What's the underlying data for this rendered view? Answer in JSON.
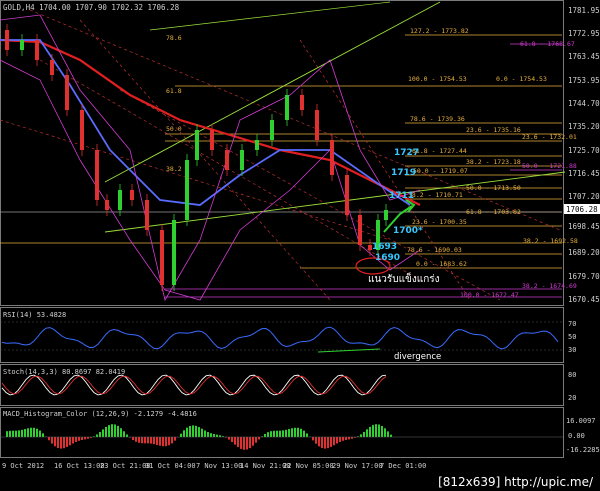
{
  "window_title": "GOLD,H4  1704.00 1707.90 1702.32 1706.28",
  "colors": {
    "background": "#000000",
    "fib_orange": "#e8b040",
    "fib_magenta": "#d23cd2",
    "ma_red": "#e02020",
    "ma_blue": "#5a6cff",
    "trend_green": "#9be03a",
    "candle_up": "#2fd02f",
    "candle_down": "#e03030",
    "cyan_text": "#38c8ff",
    "rsi_line": "#3a6cff",
    "stoch_main": "#ffffff",
    "stoch_signal": "#e03030"
  },
  "price_axis": {
    "ticks": [
      "1781.95",
      "1772.95",
      "1763.45",
      "1753.95",
      "1744.70",
      "1735.20",
      "1725.70",
      "1716.45",
      "1707.20",
      "1698.45",
      "1689.20",
      "1679.70",
      "1670.45"
    ],
    "current_price": "1706.28"
  },
  "fib_labels": [
    {
      "text": "78.6",
      "color": "orange"
    },
    {
      "text": "127.2 - 1773.82",
      "color": "orange"
    },
    {
      "text": "61.8 - 1768.67",
      "color": "magenta"
    },
    {
      "text": "100.0 - 1754.53",
      "color": "orange"
    },
    {
      "text": "0.0 - 1754.53",
      "color": "orange"
    },
    {
      "text": "61.8",
      "color": "orange"
    },
    {
      "text": "78.6 - 1739.36",
      "color": "orange"
    },
    {
      "text": "23.6 - 1735.16",
      "color": "orange"
    },
    {
      "text": "23.6 - 1732.01",
      "color": "orange"
    },
    {
      "text": "50.0",
      "color": "orange"
    },
    {
      "text": "61.8 - 1727.44",
      "color": "orange"
    },
    {
      "text": "38.2 - 1723.18",
      "color": "orange"
    },
    {
      "text": "50.0 - 1721.88",
      "color": "magenta"
    },
    {
      "text": "38.2",
      "color": "orange"
    },
    {
      "text": "50.0 - 1719.07",
      "color": "orange"
    },
    {
      "text": "50.0 - 1713.50",
      "color": "orange"
    },
    {
      "text": "38.2 - 1710.71",
      "color": "orange"
    },
    {
      "text": "61.8 - 1703.82",
      "color": "orange"
    },
    {
      "text": "23.6 - 1700.35",
      "color": "orange"
    },
    {
      "text": "38.2 - 1692.58",
      "color": "orange"
    },
    {
      "text": "78.6 - 1690.03",
      "color": "orange"
    },
    {
      "text": "0.0 - 1683.62",
      "color": "orange"
    },
    {
      "text": "38.2 - 1674.69",
      "color": "magenta"
    },
    {
      "text": "100.0 - 1672.47",
      "color": "magenta"
    }
  ],
  "annotations": {
    "level_1727": "1727",
    "level_1719": "1719",
    "level_1711": "1711",
    "level_1700": "1700*",
    "level_1693": "1693",
    "level_1690": "1690",
    "support_thai": "แนวรับแข็งแกร่ง",
    "divergence": "divergence"
  },
  "rsi_panel": {
    "label": "RSI(14) 53.4828",
    "ticks": [
      "70",
      "50",
      "30"
    ]
  },
  "stoch_panel": {
    "label": "Stoch(14,3,3) 80.8697 82.0419",
    "ticks": [
      "80",
      "20"
    ]
  },
  "macd_panel": {
    "label": "MACD_Histogram_Color (12,26,9) -2.1279 -4.4816",
    "ticks": [
      "16.0097",
      "0.00",
      "-16.2285"
    ]
  },
  "time_axis": [
    "9 Oct 2012",
    "16 Oct 13:00",
    "23 Oct 21:00",
    "31 Oct 04:00",
    "7 Nov 13:00",
    "14 Nov 21:00",
    "22 Nov 05:00",
    "29 Nov 17:00",
    "7 Dec 01:00"
  ],
  "footer": "[812x639] http://upic.me/"
}
